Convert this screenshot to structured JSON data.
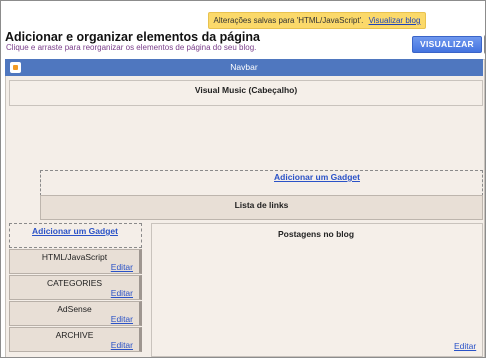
{
  "notice": {
    "text": "Alterações salvas para 'HTML/JavaScript'.",
    "link": "Visualizar blog"
  },
  "header": {
    "title": "Adicionar e organizar elementos da página",
    "subtitle": "Clique e arraste para reorganizar os elementos de página do seu blog.",
    "preview_button": "VISUALIZAR"
  },
  "layout": {
    "navbar_label": "Navbar",
    "header_section": "Visual Music (Cabeçalho)",
    "add_gadget_top": "Adicionar um Gadget",
    "links_section": "Lista de links",
    "add_gadget_sidebar": "Adicionar um Gadget",
    "main_section": "Postagens no blog",
    "main_edit": "Editar"
  },
  "sidebar": {
    "gadgets": [
      {
        "title": "HTML/JavaScript",
        "edit": "Editar"
      },
      {
        "title": "CATEGORIES",
        "edit": "Editar"
      },
      {
        "title": "AdSense",
        "edit": "Editar"
      },
      {
        "title": "ARCHIVE",
        "edit": "Editar"
      }
    ]
  }
}
